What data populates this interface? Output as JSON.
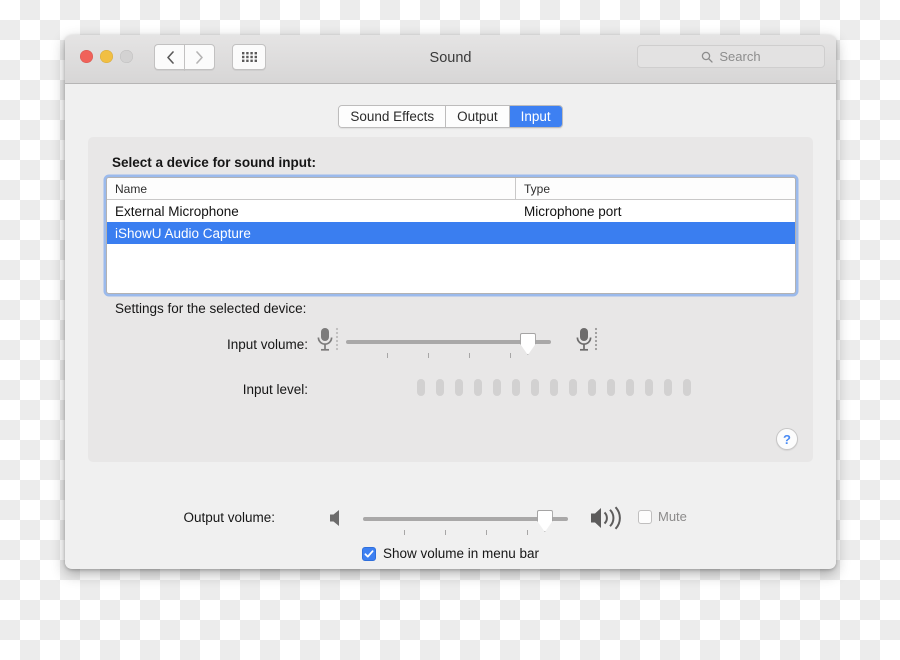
{
  "window": {
    "title": "Sound",
    "traffic_lights": [
      "close",
      "minimize",
      "zoom"
    ],
    "nav": {
      "back": "back-arrow",
      "forward": "forward-arrow",
      "grid": "show-all-grid"
    },
    "search": {
      "placeholder": "Search",
      "icon": "search-icon"
    }
  },
  "tabs": [
    {
      "label": "Sound Effects",
      "active": false
    },
    {
      "label": "Output",
      "active": false
    },
    {
      "label": "Input",
      "active": true
    }
  ],
  "panel": {
    "select_label": "Select a device for sound input:",
    "settings_label": "Settings for the selected device:",
    "table": {
      "columns": [
        "Name",
        "Type"
      ],
      "rows": [
        {
          "name": "External Microphone",
          "type": "Microphone port",
          "selected": false
        },
        {
          "name": "iShowU Audio Capture",
          "type": "",
          "selected": true
        }
      ]
    },
    "input_volume": {
      "label": "Input volume:",
      "left_icon": "microphone-low-icon",
      "right_icon": "microphone-high-icon",
      "value_percent": 92,
      "tick_count": 4
    },
    "input_level": {
      "label": "Input level:",
      "segment_count": 15,
      "active_segments": 0
    },
    "help": {
      "label": "?",
      "icon": "help-question-icon"
    }
  },
  "bottom": {
    "output_volume": {
      "label": "Output volume:",
      "left_icon": "speaker-low-icon",
      "right_icon": "speaker-high-icon",
      "value_percent": 92,
      "tick_count": 4
    },
    "mute": {
      "label": "Mute",
      "checked": false
    },
    "show_volume": {
      "label": "Show volume in menu bar",
      "checked": true
    }
  },
  "colors": {
    "accent_blue": "#3d80f2",
    "selection_blue": "#3a7ef0",
    "help_blue": "#4a8bf4",
    "window_bg": "#f0f0f0",
    "panel_bg": "#e8e7e7",
    "titlebar_top": "#e5e4e4",
    "titlebar_bottom": "#d7d6d6",
    "traffic_close": "#f0625a",
    "traffic_min": "#f1bf43",
    "traffic_zoom": "#d3d2d2"
  }
}
